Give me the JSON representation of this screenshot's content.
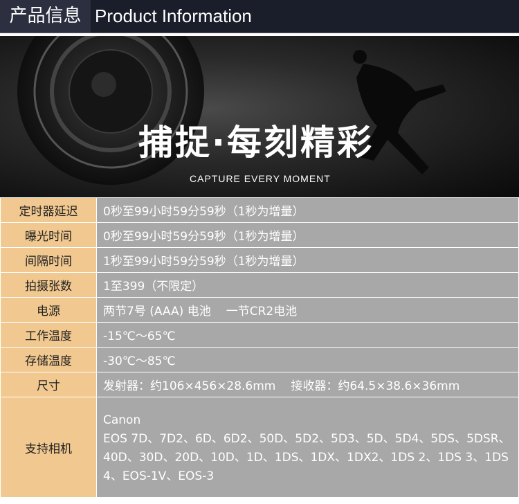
{
  "header": {
    "title_cn": "产品信息",
    "title_en": "Product Information"
  },
  "banner": {
    "title": "捕捉·每刻精彩",
    "subtitle": "CAPTURE EVERY MOMENT"
  },
  "specs": [
    {
      "label": "定时器延迟",
      "value": "0秒至99小时59分59秒（1秒为增量）"
    },
    {
      "label": "曝光时间",
      "value": "0秒至99小时59分59秒（1秒为增量）"
    },
    {
      "label": "间隔时间",
      "value": "1秒至99小时59分59秒（1秒为增量）"
    },
    {
      "label": "拍摄张数",
      "value": "1至399（不限定）"
    },
    {
      "label": "电源",
      "value": "两节7号 (AAA) 电池",
      "value2": "一节CR2电池"
    },
    {
      "label": "工作温度",
      "value": "-15℃～65℃"
    },
    {
      "label": "存储温度",
      "value": "-30℃～85℃"
    },
    {
      "label": "尺寸",
      "value": "发射器：约106×456×28.6mm",
      "value2": "接收器：约64.5×38.6×36mm"
    }
  ],
  "cameras": {
    "label": "支持相机",
    "brand": "Canon",
    "models": "EOS 7D、7D2、6D、6D2、50D、5D2、5D3、5D、5D4、5DS、5DSR、40D、30D、20D、10D、1D、1DS、1DX、1DX2、1DS 2、1DS 3、1DS 4、EOS-1V、EOS-3"
  }
}
